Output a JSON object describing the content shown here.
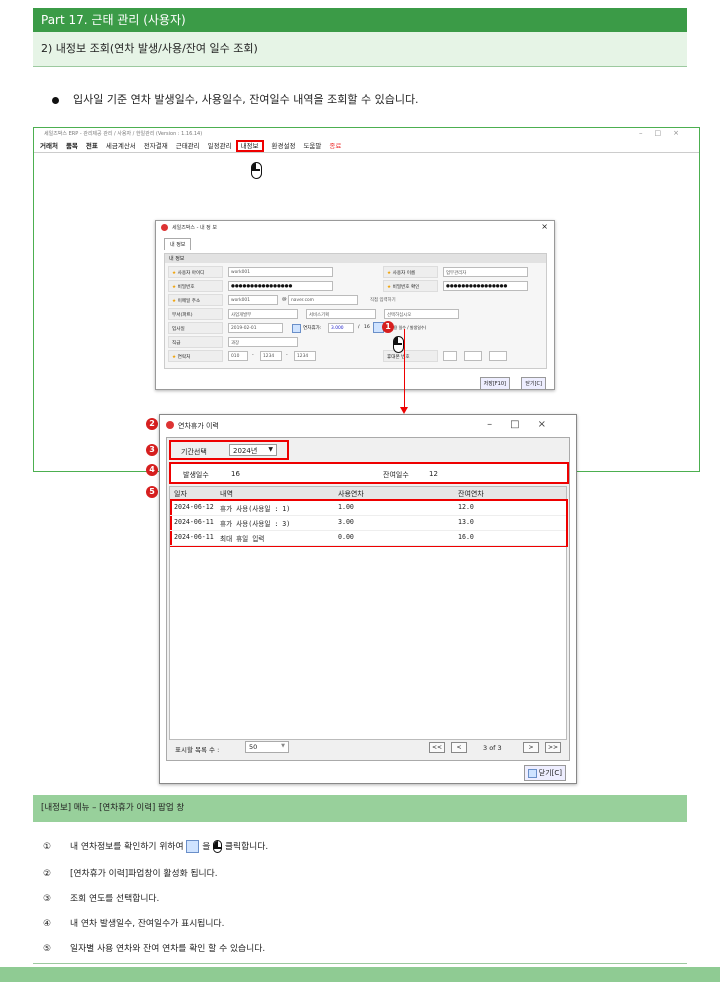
{
  "header": {
    "title": "Part 17. 근태 관리 (사용자)",
    "subtitle": "2) 내정보 조회(연차 발생/사용/잔여 일수 조회)"
  },
  "intro": "입사일 기준 연차 발생일수, 사용일수, 잔여일수 내역을 조회할 수 있습니다.",
  "app": {
    "title": "세일즈박스 ERP - 관리제공 관리 / 사용자 / 한일관리 (Version : 1.16.14)",
    "menu": [
      "거래처",
      "품목",
      "전표",
      "세금계산서",
      "전자결재",
      "근태관리",
      "일정관리",
      "내정보",
      "환경설정",
      "도움말",
      "종료"
    ]
  },
  "myinfo": {
    "title": "세일즈박스 - 내 정 보",
    "tab": "내 정보",
    "group": "내 정보",
    "labels": {
      "user_id": "사용자 아이디",
      "password": "비밀번호",
      "email": "이메일 주소",
      "dept": "부서(파트)",
      "join_date": "입사일",
      "position": "직급",
      "contact": "연락처",
      "user_name": "사용자 이름",
      "password_confirm": "비밀번호 확인",
      "mobile": "휴대폰 번호"
    },
    "values": {
      "user_id": "work001",
      "user_name": "업무관리자",
      "password": "●●●●●●●●●●●●●●●●",
      "password_confirm": "●●●●●●●●●●●●●●●●",
      "email_id": "work001",
      "email_at": "@",
      "email_domain": "naver.com",
      "email_direct": "직접 입력하기",
      "dept": "사업개발부",
      "dept2": "서비스기획",
      "dept3": "선택하십시오",
      "join_date": "2019-02-01",
      "leave_label": "연차휴가:",
      "leave_value": "3.000",
      "leave_slash": "/",
      "leave_total": "16",
      "leave_note": "사용 일수 / 발생일수)",
      "position": "과장",
      "phone1": "010",
      "phone2": "1234",
      "phone3": "1234",
      "dash": "-"
    },
    "buttons": {
      "save": "저장[F10]",
      "close": "닫기[C]"
    }
  },
  "leave": {
    "title": "연차휴가 이력",
    "period_label": "기간선택",
    "period_value": "2024년",
    "occurred_label": "발생일수",
    "occurred_value": "16",
    "remain_label": "잔여일수",
    "remain_value": "12",
    "columns": [
      "일자",
      "내역",
      "사용연차",
      "잔여연차"
    ],
    "rows": [
      {
        "date": "2024-06-12",
        "desc": "휴가 사용(사용일 : 1)",
        "used": "1.00",
        "remain": "12.0"
      },
      {
        "date": "2024-06-11",
        "desc": "휴가 사용(사용일 : 3)",
        "used": "3.00",
        "remain": "13.0"
      },
      {
        "date": "2024-06-11",
        "desc": "최대 휴일 입력",
        "used": "0.00",
        "remain": "16.0"
      }
    ],
    "list_count_label": "표시할 목록 수 :",
    "list_count_value": "50",
    "pager": {
      "first": "<<",
      "prev": "<",
      "text": "3 of 3",
      "next": ">",
      "last": ">>"
    },
    "close": "닫기[C]"
  },
  "badges": [
    "1",
    "2",
    "3",
    "4",
    "5"
  ],
  "footer": {
    "title": "[내정보] 메뉴 – [연차휴가 이력] 팝업 창",
    "items": [
      {
        "n": "①",
        "pre": "내 연차정보를 확인하기 위하여",
        "mid": "을",
        "post": "클릭합니다."
      },
      {
        "n": "②",
        "text": "[연차휴가 이력]파업창이 활성화 됩니다."
      },
      {
        "n": "③",
        "text": "조회 연도를 선택합니다."
      },
      {
        "n": "④",
        "text": "내 연차 발생일수, 잔여일수가 표시됩니다."
      },
      {
        "n": "⑤",
        "text": "일자별 사용 연차와 잔여 연차를 확인 할 수 있습니다."
      }
    ]
  }
}
